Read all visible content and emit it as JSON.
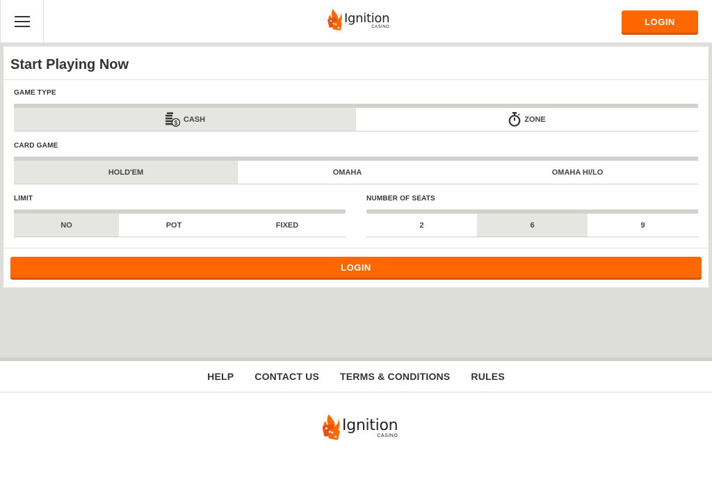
{
  "header": {
    "logo_name": "Ignition",
    "logo_sub": "CASINO",
    "login_label": "LOGIN"
  },
  "card": {
    "title": "Start Playing Now",
    "game_type": {
      "label": "GAME TYPE",
      "options": [
        {
          "label": "CASH",
          "icon": "cash-stack-icon",
          "active": true
        },
        {
          "label": "ZONE",
          "icon": "stopwatch-icon",
          "active": false
        }
      ]
    },
    "card_game": {
      "label": "CARD GAME",
      "options": [
        {
          "label": "HOLD'EM",
          "active": true
        },
        {
          "label": "OMAHA",
          "active": false
        },
        {
          "label": "OMAHA HI/LO",
          "active": false
        }
      ]
    },
    "limit": {
      "label": "LIMIT",
      "options": [
        {
          "label": "NO",
          "active": true
        },
        {
          "label": "POT",
          "active": false
        },
        {
          "label": "FIXED",
          "active": false
        }
      ]
    },
    "seats": {
      "label": "NUMBER OF SEATS",
      "options": [
        {
          "label": "2",
          "active": false
        },
        {
          "label": "6",
          "active": true
        },
        {
          "label": "9",
          "active": false
        }
      ]
    },
    "login_label": "LOGIN"
  },
  "footer": {
    "links": [
      "HELP",
      "CONTACT US",
      "TERMS & CONDITIONS",
      "RULES"
    ],
    "logo_name": "Ignition",
    "logo_sub": "CASINO"
  },
  "colors": {
    "accent": "#ff6800",
    "active_option": "#e5e5e1",
    "background_gray": "#ddddd9"
  }
}
